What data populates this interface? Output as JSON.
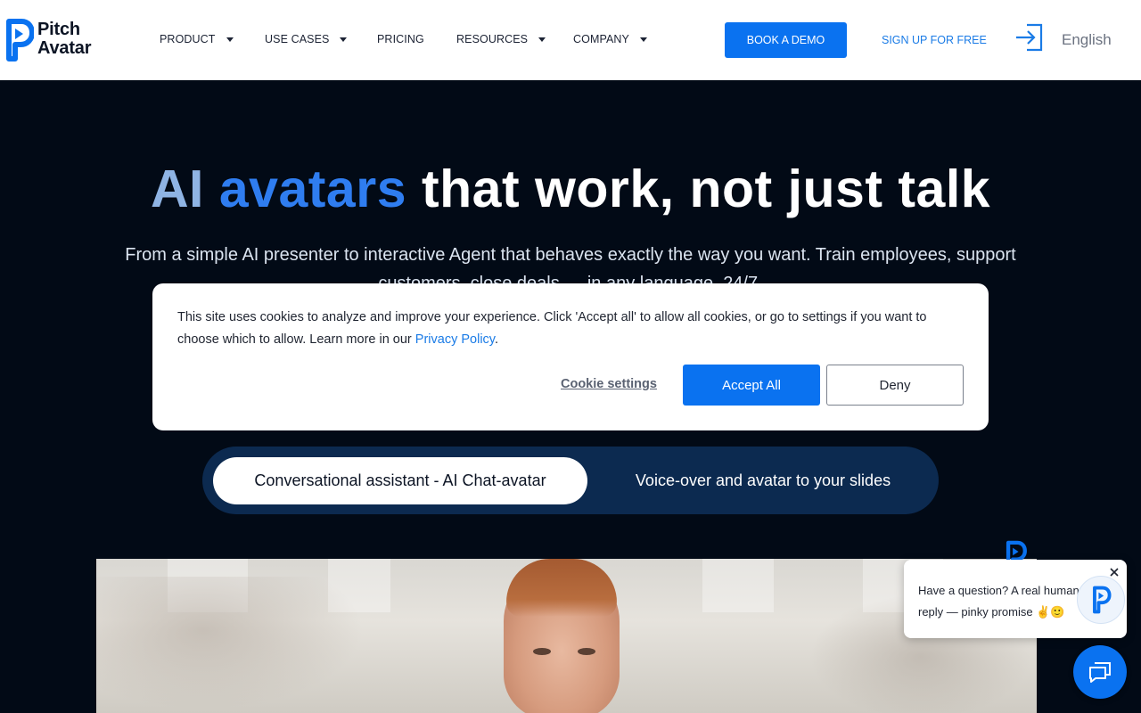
{
  "brand": {
    "name_line1": "Pitch",
    "name_line2": "Avatar",
    "accent_color": "#0a72f0"
  },
  "nav": {
    "items": [
      {
        "label": "PRODUCT",
        "has_dropdown": true
      },
      {
        "label": "USE CASES",
        "has_dropdown": true
      },
      {
        "label": "PRICING",
        "has_dropdown": false
      },
      {
        "label": "RESOURCES",
        "has_dropdown": true
      },
      {
        "label": "COMPANY",
        "has_dropdown": true
      }
    ],
    "book_demo": "BOOK A DEMO",
    "signup": "SIGN UP FOR FREE",
    "login_icon": "login-icon",
    "language": "English"
  },
  "hero": {
    "title_ai": "AI",
    "title_avatars": "avatars",
    "title_rest": "that work, not just talk",
    "subtitle": "From a simple AI presenter to interactive Agent that behaves exactly the way you want. Train employees, support customers, close deals — in any language, 24/7."
  },
  "tabs": {
    "active": "Conversational assistant - AI Chat-avatar",
    "inactive": "Voice-over and avatar to your slides"
  },
  "cookie_banner": {
    "text": "This site uses cookies to analyze and improve your experience. Click 'Accept all' to allow all cookies, or go to settings if you want to choose which to allow. Learn more in our ",
    "privacy_link": "Privacy Policy",
    "period": ".",
    "settings": "Cookie settings",
    "accept": "Accept All",
    "deny": "Deny"
  },
  "chat": {
    "message_line1": "Have a question? A real human will",
    "message_line2": "reply — pinky promise ✌️🙂",
    "close_icon": "close-icon",
    "launcher_icon": "chat-icon"
  }
}
